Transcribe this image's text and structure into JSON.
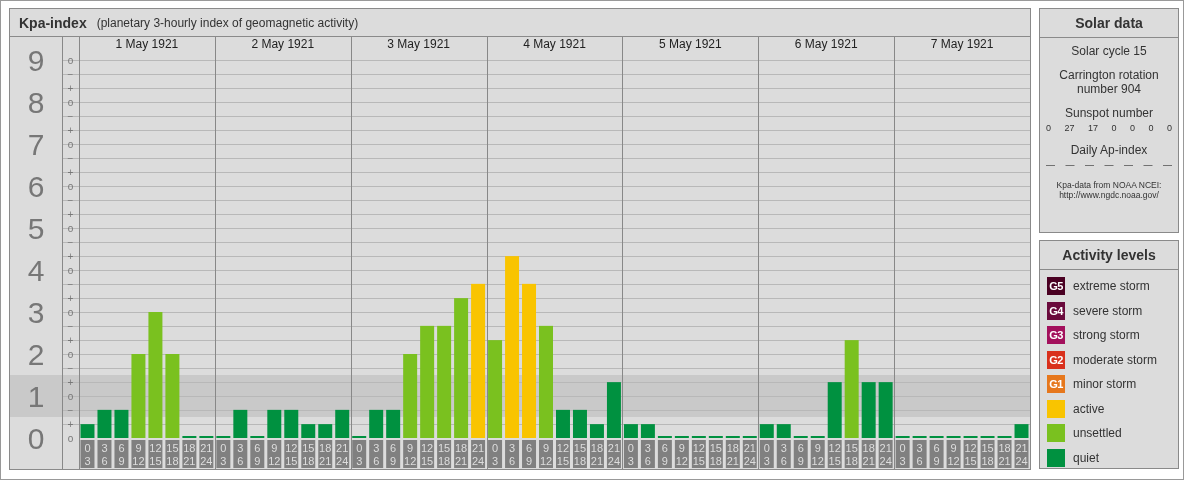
{
  "kpa_chart": {
    "title": "Kpa-index",
    "subtitle": "(planetary 3-hourly index of geomagnetic activity)",
    "days": [
      "1 May 1921",
      "2 May 1921",
      "3 May 1921",
      "4 May 1921",
      "5 May 1921",
      "6 May 1921",
      "7 May 1921"
    ],
    "scale_marks": [
      "o",
      "−",
      "+",
      "o",
      "−",
      "+",
      "o",
      "−",
      "+",
      "o",
      "−",
      "+",
      "o",
      "−",
      "+",
      "o",
      "−",
      "+",
      "o",
      "−",
      "+",
      "o",
      "−",
      "+",
      "o",
      "−",
      "+",
      "o"
    ],
    "chart_data": {
      "type": "bar",
      "stacked": true,
      "grid": true,
      "categories": [
        "0\n3",
        "3\n6",
        "6\n9",
        "9\n12",
        "12\n15",
        "15\n18",
        "18\n21",
        "21\n24",
        "0\n3",
        "3\n6",
        "6\n9",
        "9\n12",
        "12\n15",
        "15\n18",
        "18\n21",
        "21\n24",
        "0\n3",
        "3\n6",
        "6\n9",
        "9\n12",
        "12\n15",
        "15\n18",
        "18\n21",
        "21\n24",
        "0\n3",
        "3\n6",
        "6\n9",
        "9\n12",
        "12\n15",
        "15\n18",
        "18\n21",
        "21\n24",
        "0\n3",
        "3\n6",
        "6\n9",
        "9\n12",
        "12\n15",
        "15\n18",
        "18\n21",
        "21\n24",
        "0\n3",
        "3\n6",
        "6\n9",
        "9\n12",
        "12\n15",
        "15\n18",
        "18\n21",
        "21\n24",
        "0\n3",
        "3\n6",
        "6\n9",
        "9\n12",
        "12\n15",
        "15\n18",
        "18\n21",
        "21\n24"
      ],
      "ylim": [
        0,
        9
      ],
      "yticks": [
        {
          "value": 0,
          "label": "0"
        },
        {
          "value": 1,
          "label": "1"
        },
        {
          "value": 2,
          "label": "2"
        },
        {
          "value": 3,
          "label": "3"
        },
        {
          "value": 4,
          "label": "4"
        },
        {
          "value": 5,
          "label": "5"
        },
        {
          "value": 6,
          "label": "6"
        },
        {
          "value": 7,
          "label": "7"
        },
        {
          "value": 8,
          "label": "8"
        },
        {
          "value": 9,
          "label": "9"
        }
      ],
      "series": [
        {
          "color": "#009140",
          "values": [
            0.33,
            0.67,
            0.67,
            null,
            null,
            null,
            0,
            0,
            0,
            0.67,
            0,
            0.67,
            0.67,
            0.33,
            0.33,
            0.67,
            0,
            0.67,
            0.67,
            null,
            null,
            null,
            null,
            null,
            null,
            null,
            null,
            null,
            0.67,
            0.67,
            0.33,
            1.33,
            0.33,
            0.33,
            0,
            0,
            0,
            0,
            0,
            0,
            0.33,
            0.33,
            0,
            0,
            1.33,
            null,
            1.33,
            1.33,
            0,
            0,
            0,
            0,
            0,
            0,
            0,
            0.33
          ]
        },
        {
          "color": "#7ac11f",
          "values": [
            null,
            null,
            null,
            2,
            3,
            2,
            null,
            null,
            null,
            null,
            null,
            null,
            null,
            null,
            null,
            null,
            null,
            null,
            null,
            2,
            2.67,
            2.67,
            3.33,
            null,
            2.33,
            null,
            null,
            2.67,
            null,
            null,
            null,
            null,
            null,
            null,
            null,
            null,
            null,
            null,
            null,
            null,
            null,
            null,
            null,
            null,
            null,
            2.33,
            null,
            null,
            null,
            null,
            null,
            null,
            null,
            null,
            null,
            null
          ]
        },
        {
          "color": "#f9c400",
          "values": [
            null,
            null,
            null,
            null,
            null,
            null,
            null,
            null,
            null,
            null,
            null,
            null,
            null,
            null,
            null,
            null,
            null,
            null,
            null,
            null,
            null,
            null,
            null,
            3.67,
            null,
            4.33,
            3.67,
            null,
            null,
            null,
            null,
            null,
            null,
            null,
            null,
            null,
            null,
            null,
            null,
            null,
            null,
            null,
            null,
            null,
            null,
            null,
            null,
            null,
            null,
            null,
            null,
            null,
            null,
            null,
            null,
            null
          ]
        }
      ]
    }
  },
  "solar_data": {
    "title": "Solar data",
    "solar_cycle": "Solar cycle 15",
    "carrington": "Carrington rotation number 904",
    "sunspot_label": "Sunspot number",
    "sunspot_numbers": [
      "0",
      "27",
      "17",
      "0",
      "0",
      "0",
      "0"
    ],
    "ap_label": "Daily Ap-index",
    "ap_values": [
      "—",
      "—",
      "—",
      "—",
      "—",
      "—",
      "—"
    ],
    "source": [
      "Kpa-data from NOAA NCEI:",
      "http://www.ngdc.noaa.gov/"
    ]
  },
  "activity_levels": {
    "title": "Activity levels",
    "items": [
      {
        "badge": "G5",
        "label": "extreme storm",
        "color": "#4a0022"
      },
      {
        "badge": "G4",
        "label": "severe storm",
        "color": "#6a0a3c"
      },
      {
        "badge": "G3",
        "label": "strong storm",
        "color": "#a3105c"
      },
      {
        "badge": "G2",
        "label": "moderate storm",
        "color": "#d9301c"
      },
      {
        "badge": "G1",
        "label": "minor storm",
        "color": "#e6771c"
      },
      {
        "label": "active",
        "color": "#f9c400"
      },
      {
        "label": "unsettled",
        "color": "#7ac11f"
      },
      {
        "label": "quiet",
        "color": "#009140"
      }
    ]
  }
}
